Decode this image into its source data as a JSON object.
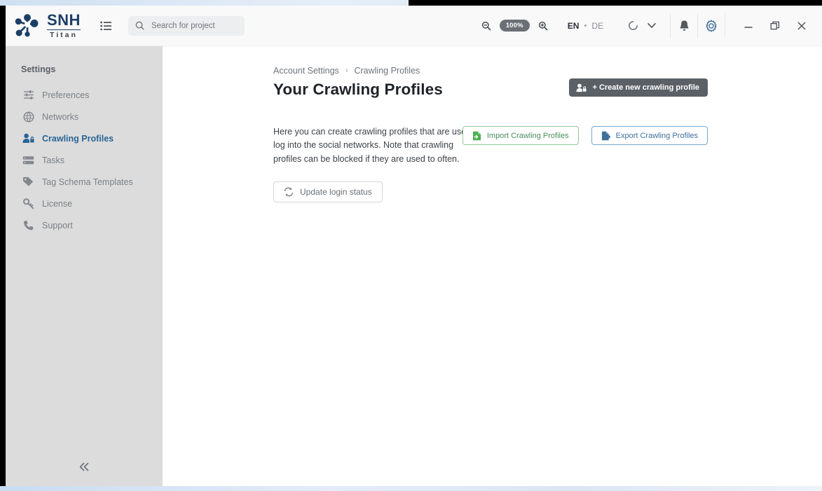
{
  "app": {
    "logo_primary": "SNH",
    "logo_secondary": "Titan",
    "logo_icon": "network-nodes-icon"
  },
  "header": {
    "list_icon": "list-view-icon",
    "search": {
      "icon": "search-icon",
      "placeholder": "Search for project",
      "value": ""
    },
    "zoom": {
      "out_icon": "zoom-out-icon",
      "level": "100%",
      "in_icon": "zoom-in-icon"
    },
    "language": {
      "active": "EN",
      "separator": "•",
      "inactive": "DE"
    },
    "sync_icon": "sync-spinner-icon",
    "chevron_icon": "chevron-down-icon",
    "notifications_icon": "bell-icon",
    "settings_icon": "gear-icon",
    "window_controls": {
      "minimize": "minimize-icon",
      "restore": "restore-icon",
      "close": "close-icon"
    }
  },
  "sidebar": {
    "title": "Settings",
    "collapse_icon": "chevron-double-left-icon",
    "items": [
      {
        "label": "Preferences",
        "icon": "sliders-icon",
        "active": false
      },
      {
        "label": "Networks",
        "icon": "globe-icon",
        "active": false
      },
      {
        "label": "Crawling Profiles",
        "icon": "user-lock-icon",
        "active": true
      },
      {
        "label": "Tasks",
        "icon": "server-stack-icon",
        "active": false
      },
      {
        "label": "Tag Schema Templates",
        "icon": "tag-icon",
        "active": false
      },
      {
        "label": "License",
        "icon": "key-icon",
        "active": false
      },
      {
        "label": "Support",
        "icon": "phone-icon",
        "active": false
      }
    ]
  },
  "main": {
    "breadcrumb": {
      "parent": "Account Settings",
      "separator": "›",
      "current": "Crawling Profiles"
    },
    "title": "Your Crawling Profiles",
    "create_button": {
      "label": "+ Create new crawling profile",
      "icon": "user-lock-icon"
    },
    "description": "Here you can create crawling profiles that are used to log into the social networks. Note that crawling profiles can be blocked if they are used to often.",
    "import_button": {
      "label": "Import Crawling Profiles",
      "icon": "file-import-icon"
    },
    "export_button": {
      "label": "Export Crawling Profiles",
      "icon": "file-export-icon"
    },
    "update_button": {
      "label": "Update login status",
      "icon": "refresh-icon"
    }
  },
  "colors": {
    "accent_blue": "#2a6496",
    "import_green": "#4b8f5c",
    "export_blue": "#3f6f9b",
    "dark_button": "#5b6067",
    "sidebar_bg": "#dcdcdc"
  }
}
